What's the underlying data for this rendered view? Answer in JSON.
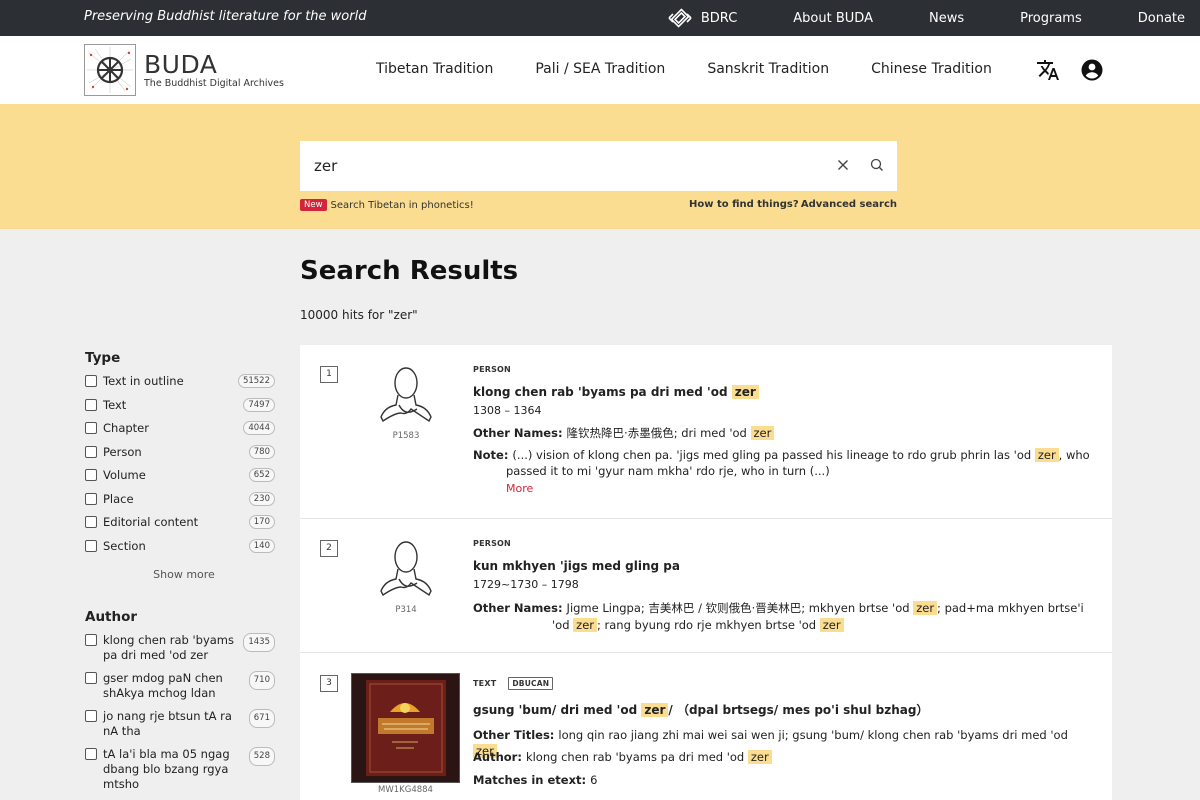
{
  "topbar": {
    "tagline": "Preserving Buddhist literature for the world",
    "links": [
      "BDRC",
      "About BUDA",
      "News",
      "Programs",
      "Donate"
    ]
  },
  "header": {
    "logo_title": "BUDA",
    "logo_subtitle": "The Buddhist Digital Archives",
    "nav": [
      "Tibetan Tradition",
      "Pali / SEA Tradition",
      "Sanskrit Tradition",
      "Chinese Tradition"
    ],
    "icons": [
      "translate-icon",
      "account-icon"
    ]
  },
  "search": {
    "value": "zer",
    "new_badge": "New",
    "phonetics_link": "Search Tibetan in phonetics!",
    "howto_link": "How to find things?",
    "advanced_link": "Advanced search"
  },
  "results_header": {
    "title": "Search Results",
    "count": "10000 hits for \"zer\""
  },
  "sidebar": {
    "type_title": "Type",
    "type_facets": [
      {
        "label": "Text in outline",
        "count": "51522"
      },
      {
        "label": "Text",
        "count": "7497"
      },
      {
        "label": "Chapter",
        "count": "4044"
      },
      {
        "label": "Person",
        "count": "780"
      },
      {
        "label": "Volume",
        "count": "652"
      },
      {
        "label": "Place",
        "count": "230"
      },
      {
        "label": "Editorial content",
        "count": "170"
      },
      {
        "label": "Section",
        "count": "140"
      }
    ],
    "show_more": "Show more",
    "author_title": "Author",
    "author_facets": [
      {
        "label": "klong chen rab 'byams pa dri med 'od zer",
        "count": "1435"
      },
      {
        "label": "gser mdog paN chen shAkya mchog ldan",
        "count": "710"
      },
      {
        "label": "jo nang rje btsun tA ra nA tha",
        "count": "671"
      },
      {
        "label": "tA la'i bla ma 05 ngag dbang blo bzang rgya mtsho",
        "count": "528"
      }
    ]
  },
  "results": [
    {
      "num": "1",
      "type": "PERSON",
      "id": "P1583",
      "title_pre": "klong chen rab 'byams pa dri med 'od ",
      "title_hl": "zer",
      "dates": "1308 – 1364",
      "other_names_label": "Other Names:",
      "other_names_pre": "隆钦热降巴·赤墨俄色; dri med 'od ",
      "other_names_hl": "zer",
      "note_label": "Note:",
      "note_pre": "(...) vision of klong chen pa. 'jigs med gling pa passed his lineage to rdo grub phrin las 'od ",
      "note_hl": "zer",
      "note_post": ", who passed it to mi 'gyur nam mkha' rdo rje, who in turn (...)",
      "more": "More"
    },
    {
      "num": "2",
      "type": "PERSON",
      "id": "P314",
      "title": "kun mkhyen 'jigs med gling pa",
      "dates": "1729~1730 – 1798",
      "other_names_label": "Other Names:",
      "other_names_a": "Jigme Lingpa; 吉美林巴 / 钦则俄色·晋美林巴; mkhyen brtse 'od ",
      "hl1": "zer",
      "other_names_b": "; pad+ma mkhyen brtse'i 'od ",
      "hl2": "zer",
      "other_names_c": "; rang byung rdo rje mkhyen brtse 'od ",
      "hl3": "zer"
    },
    {
      "num": "3",
      "type": "TEXT",
      "tag": "DBUCAN",
      "id": "MW1KG4884",
      "title_pre": "gsung 'bum/ dri med 'od ",
      "title_hl": "zer",
      "title_post": "/ （dpal brtsegs/ mes po'i shul bzhag）",
      "other_titles_label": "Other Titles:",
      "other_titles_pre": "long qin rao jiang zhi mai wei sai wen ji; gsung 'bum/ klong chen rab 'byams dri med 'od ",
      "other_titles_hl": "zer",
      "author_label": "Author:",
      "author_pre": "klong chen rab 'byams pa dri med 'od ",
      "author_hl": "zer",
      "matches_label": "Matches in etext:",
      "matches_value": "6"
    }
  ],
  "colors": {
    "topbar": "#2c2f33",
    "search_band": "#fadd91",
    "highlight": "#fadd91",
    "accent_red": "#d4243a"
  }
}
